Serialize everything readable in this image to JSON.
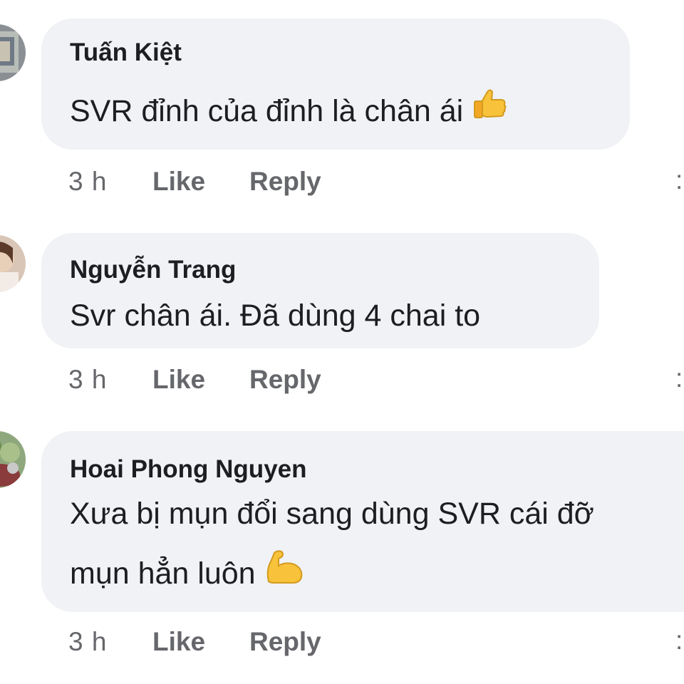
{
  "comments": [
    {
      "author": "Tuấn Kiệt",
      "text": "SVR đỉnh của đỉnh là chân ái",
      "emoji": "thumbs-up-icon",
      "time": "3 h",
      "like_label": "Like",
      "reply_label": "Reply"
    },
    {
      "author": "Nguyễn Trang",
      "text": "Svr chân ái. Đã dùng 4 chai to",
      "time": "3 h",
      "like_label": "Like",
      "reply_label": "Reply"
    },
    {
      "author": "Hoai Phong Nguyen",
      "text_line1": "Xưa bị mụn đổi sang dùng SVR cái đỡ",
      "text_line2": "mụn hẳn luôn",
      "emoji": "flexed-biceps-icon",
      "time": "3 h",
      "like_label": "Like",
      "reply_label": "Reply"
    }
  ],
  "colors": {
    "bubble": "#f0f2f5",
    "meta_text": "#65676b",
    "body_text": "#1c1e21"
  }
}
